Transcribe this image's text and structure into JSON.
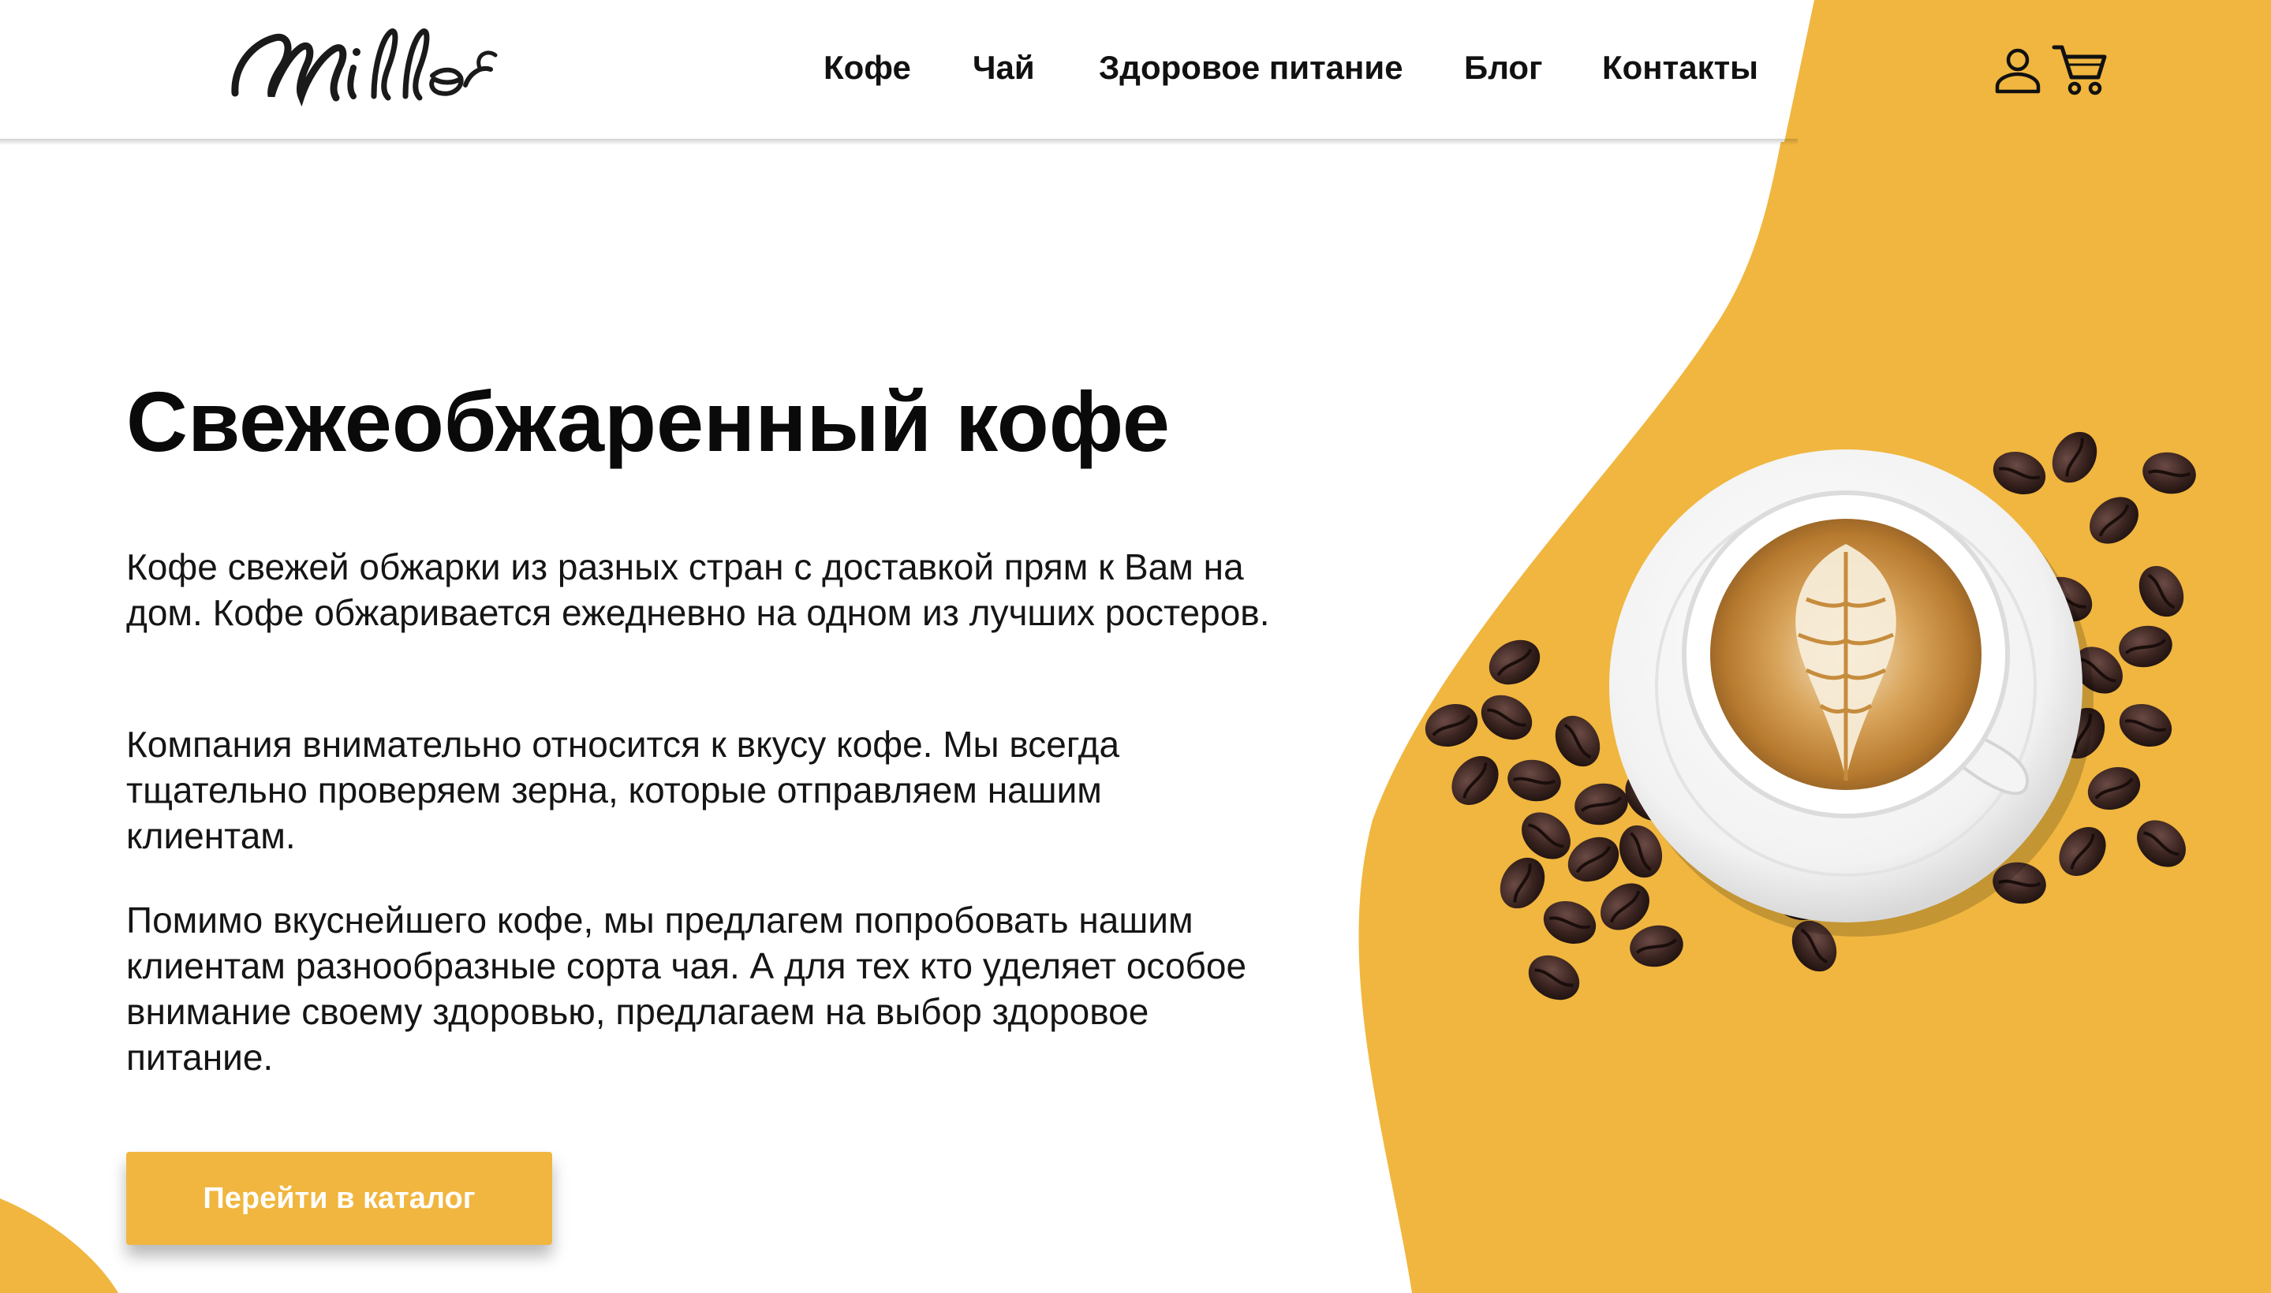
{
  "brand": {
    "logo_text": "Miller",
    "accent_color": "#f0b63f",
    "text_color": "#111111"
  },
  "nav": {
    "items": [
      {
        "label": "Кофе"
      },
      {
        "label": "Чай"
      },
      {
        "label": "Здоровое питание"
      },
      {
        "label": "Блог"
      },
      {
        "label": "Контакты"
      }
    ]
  },
  "header_icons": {
    "user": "user-icon",
    "cart": "cart-icon"
  },
  "hero": {
    "title": "Свежеобжаренный кофе",
    "paragraphs": [
      "Кофе свежей обжарки из разных стран с доставкой прям к Вам на дом. Кофе обжаривается ежедневно на одном из лучших ростеров.",
      "Компания внимательно относится к вкусу кофе. Мы всегда тщательно проверяем зерна, которые отправляем нашим клиентам.",
      "Помимо вкуснейшего кофе, мы предлагем попробовать нашим клиентам разнообразные сорта чая. А для тех кто уделяет особое внимание своему здоровью, предлагаем на выбор здоровое питание."
    ],
    "cta_label": "Перейти в каталог"
  }
}
